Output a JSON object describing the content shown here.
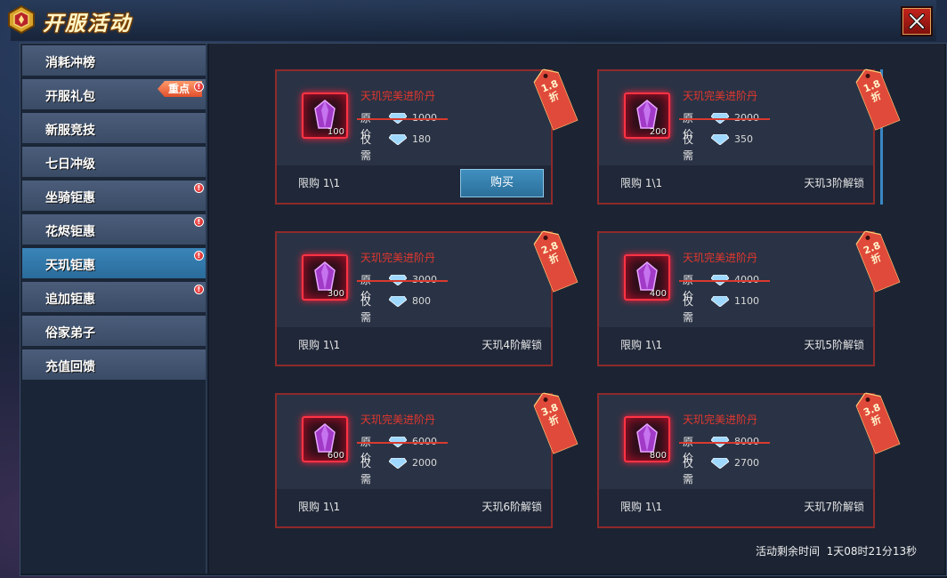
{
  "window": {
    "title": "开服活动"
  },
  "sidebar": {
    "items": [
      {
        "label": "消耗冲榜",
        "badge": ""
      },
      {
        "label": "开服礼包",
        "badge": "ribbon",
        "ribbon_text": "重点"
      },
      {
        "label": "新服竞技",
        "badge": ""
      },
      {
        "label": "七日冲级",
        "badge": ""
      },
      {
        "label": "坐骑钜惠",
        "badge": "dot"
      },
      {
        "label": "花烬钜惠",
        "badge": "dot"
      },
      {
        "label": "天玑钜惠",
        "badge": "dot",
        "active": true
      },
      {
        "label": "追加钜惠",
        "badge": "dot"
      },
      {
        "label": "俗家弟子",
        "badge": ""
      },
      {
        "label": "充值回馈",
        "badge": ""
      }
    ]
  },
  "cards": [
    {
      "name": "天玑完美进阶丹",
      "qty": "100",
      "orig_label": "原价",
      "orig": "1000",
      "need_label": "仅需",
      "need": "180",
      "limit": "限购 1\\1",
      "discount": "1.8折",
      "action": "购买",
      "unlock": ""
    },
    {
      "name": "天玑完美进阶丹",
      "qty": "200",
      "orig_label": "原价",
      "orig": "2000",
      "need_label": "仅需",
      "need": "350",
      "limit": "限购 1\\1",
      "discount": "1.8折",
      "action": "",
      "unlock": "天玑3阶解锁"
    },
    {
      "name": "天玑完美进阶丹",
      "qty": "300",
      "orig_label": "原价",
      "orig": "3000",
      "need_label": "仅需",
      "need": "800",
      "limit": "限购 1\\1",
      "discount": "2.8折",
      "action": "",
      "unlock": "天玑4阶解锁"
    },
    {
      "name": "天玑完美进阶丹",
      "qty": "400",
      "orig_label": "原价",
      "orig": "4000",
      "need_label": "仅需",
      "need": "1100",
      "limit": "限购 1\\1",
      "discount": "2.8折",
      "action": "",
      "unlock": "天玑5阶解锁"
    },
    {
      "name": "天玑完美进阶丹",
      "qty": "600",
      "orig_label": "原价",
      "orig": "6000",
      "need_label": "仅需",
      "need": "2000",
      "limit": "限购 1\\1",
      "discount": "3.8折",
      "action": "",
      "unlock": "天玑6阶解锁"
    },
    {
      "name": "天玑完美进阶丹",
      "qty": "800",
      "orig_label": "原价",
      "orig": "8000",
      "need_label": "仅需",
      "need": "2700",
      "limit": "限购 1\\1",
      "discount": "3.8折",
      "action": "",
      "unlock": "天玑7阶解锁"
    }
  ],
  "footer": {
    "timer_label": "活动剩余时间",
    "timer_value": "1天08时21分13秒"
  },
  "colors": {
    "accent_blue": "#2c6f9a",
    "card_border": "#8e2a2a",
    "item_name": "#e2372e",
    "tag": "#e04a3a"
  },
  "icons": {
    "close": "close-icon",
    "gem": "diamond-icon",
    "crystal": "crystal-icon",
    "badge": "crown-badge-icon"
  }
}
